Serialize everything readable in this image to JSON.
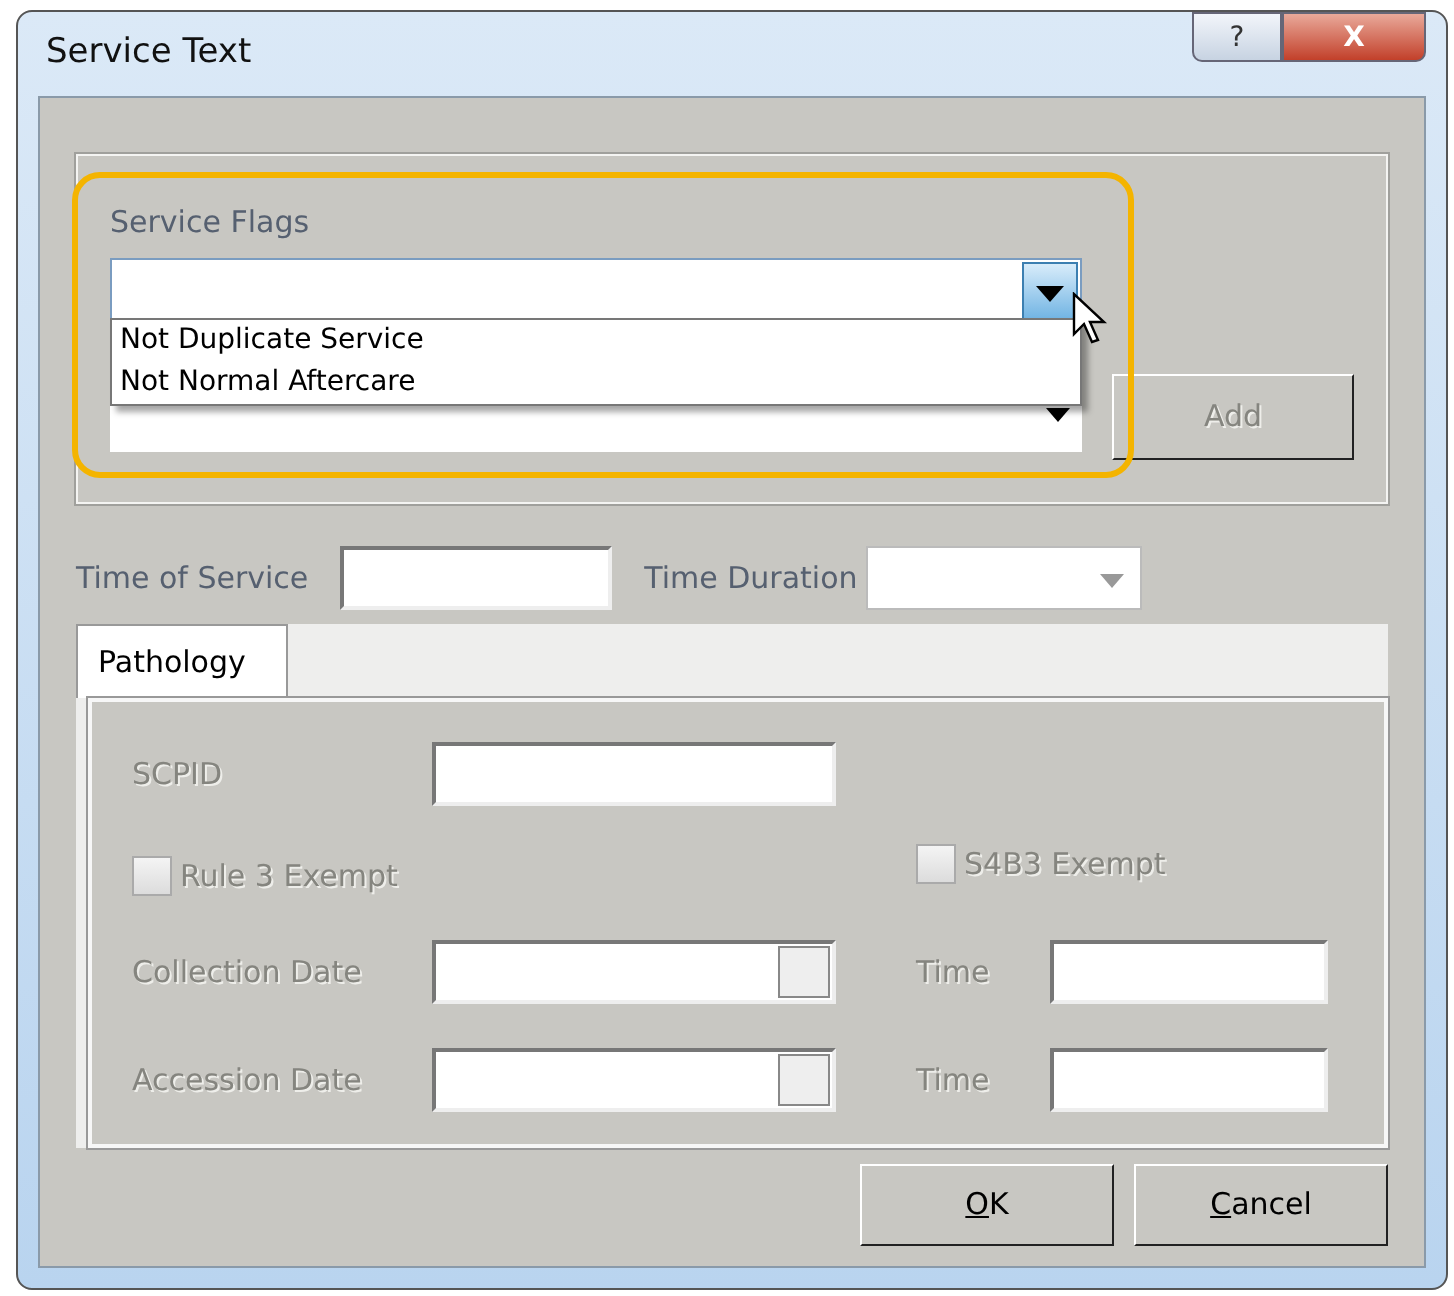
{
  "window": {
    "title": "Service Text",
    "help_button": "?",
    "close_button": "X"
  },
  "service_flags": {
    "label": "Service Flags",
    "expanded": true,
    "options": [
      {
        "label": "Not Duplicate Service",
        "selected": false
      },
      {
        "label": "Not Normal Aftercare",
        "selected": false
      }
    ],
    "highlighted": true
  },
  "add_button": {
    "label": "Add",
    "disabled": true
  },
  "time_of_service": {
    "label": "Time of Service"
  },
  "time_duration": {
    "label": "Time Duration"
  },
  "tabs": [
    {
      "label": "Pathology",
      "selected": true
    }
  ],
  "pathology": {
    "disabled": true,
    "scpid": {
      "label": "SCPID"
    },
    "checkboxes": [
      {
        "label": "Rule 3 Exempt",
        "checked": false
      },
      {
        "label": "S4B3 Exempt",
        "checked": false
      }
    ],
    "dates": [
      {
        "label": "Collection Date",
        "time_label": "Time"
      },
      {
        "label": "Accession Date",
        "time_label": "Time"
      }
    ]
  },
  "buttons": [
    {
      "label": "OK",
      "accelerator_underlined": true
    },
    {
      "label": "Cancel",
      "accelerator_underlined": true
    }
  ]
}
